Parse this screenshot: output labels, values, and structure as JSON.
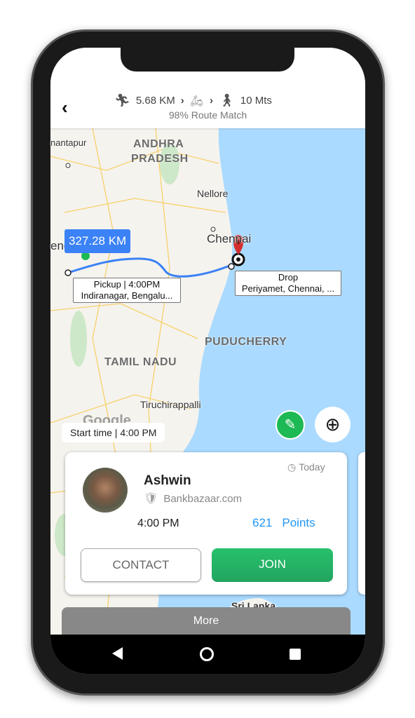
{
  "header": {
    "back_icon": "chevron-left",
    "walk_distance": "5.68 KM",
    "ride_icon": "scooter",
    "walk_icon": "walking-person",
    "walk_time": "10 Mts",
    "route_match": "98% Route Match"
  },
  "map": {
    "labels": {
      "anantapur": "nantapur",
      "andhra": "ANDHRA",
      "pradesh": "PRADESH",
      "nellore": "Nellore",
      "chennai": "Chennai",
      "bengaluru": "eng",
      "puducherry": "PUDUCHERRY",
      "tamil_nadu": "TAMIL NADU",
      "tiruchirappalli": "Tiruchirappalli",
      "sri_lanka": "Sri Lanka",
      "google": "Google"
    },
    "distance_badge": "327.28 KM",
    "pickup": {
      "line1": "Pickup | 4:00PM",
      "line2": "Indiranagar, Bengalu..."
    },
    "drop": {
      "line1": "Drop",
      "line2": "Periyamet, Chennai, ..."
    },
    "start_time": "Start time | 4:00 PM",
    "colors": {
      "land": "#f5f3ee",
      "sea": "#aadaff",
      "route": "#3b82f6",
      "pin": "#d32f2f",
      "edit": "#1db954"
    }
  },
  "card": {
    "name": "Ashwin",
    "company": "Bankbazaar.com",
    "day": "Today",
    "time": "4:00 PM",
    "points_value": "621",
    "points_label": "Points",
    "contact_label": "CONTACT",
    "join_label": "JOIN"
  },
  "more_label": "More"
}
